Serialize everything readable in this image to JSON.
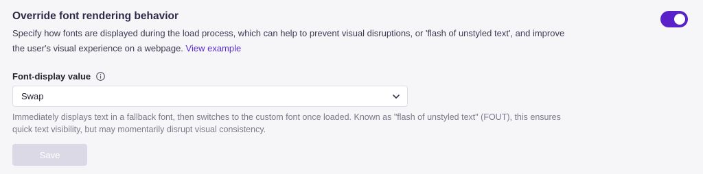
{
  "setting": {
    "title": "Override font rendering behavior",
    "description": "Specify how fonts are displayed during the load process, which can help to prevent visual disruptions, or 'flash of unstyled text', and improve the user's visual experience on a webpage.",
    "link_label": "View example",
    "toggle_on": true
  },
  "field": {
    "label": "Font-display value",
    "info_icon": "info-icon",
    "selected_value": "Swap",
    "dropdown_icon": "chevron-down-icon",
    "help_text": "Immediately displays text in a fallback font, then switches to the custom font once loaded. Known as \"flash of unstyled text\" (FOUT), this ensures quick text visibility, but may momentarily disrupt visual consistency."
  },
  "actions": {
    "save_label": "Save",
    "save_enabled": false
  },
  "colors": {
    "accent": "#5a20c9",
    "link": "#5b2bd1",
    "disabled_button": "#dcd9e6",
    "background": "#f6f6f8"
  }
}
